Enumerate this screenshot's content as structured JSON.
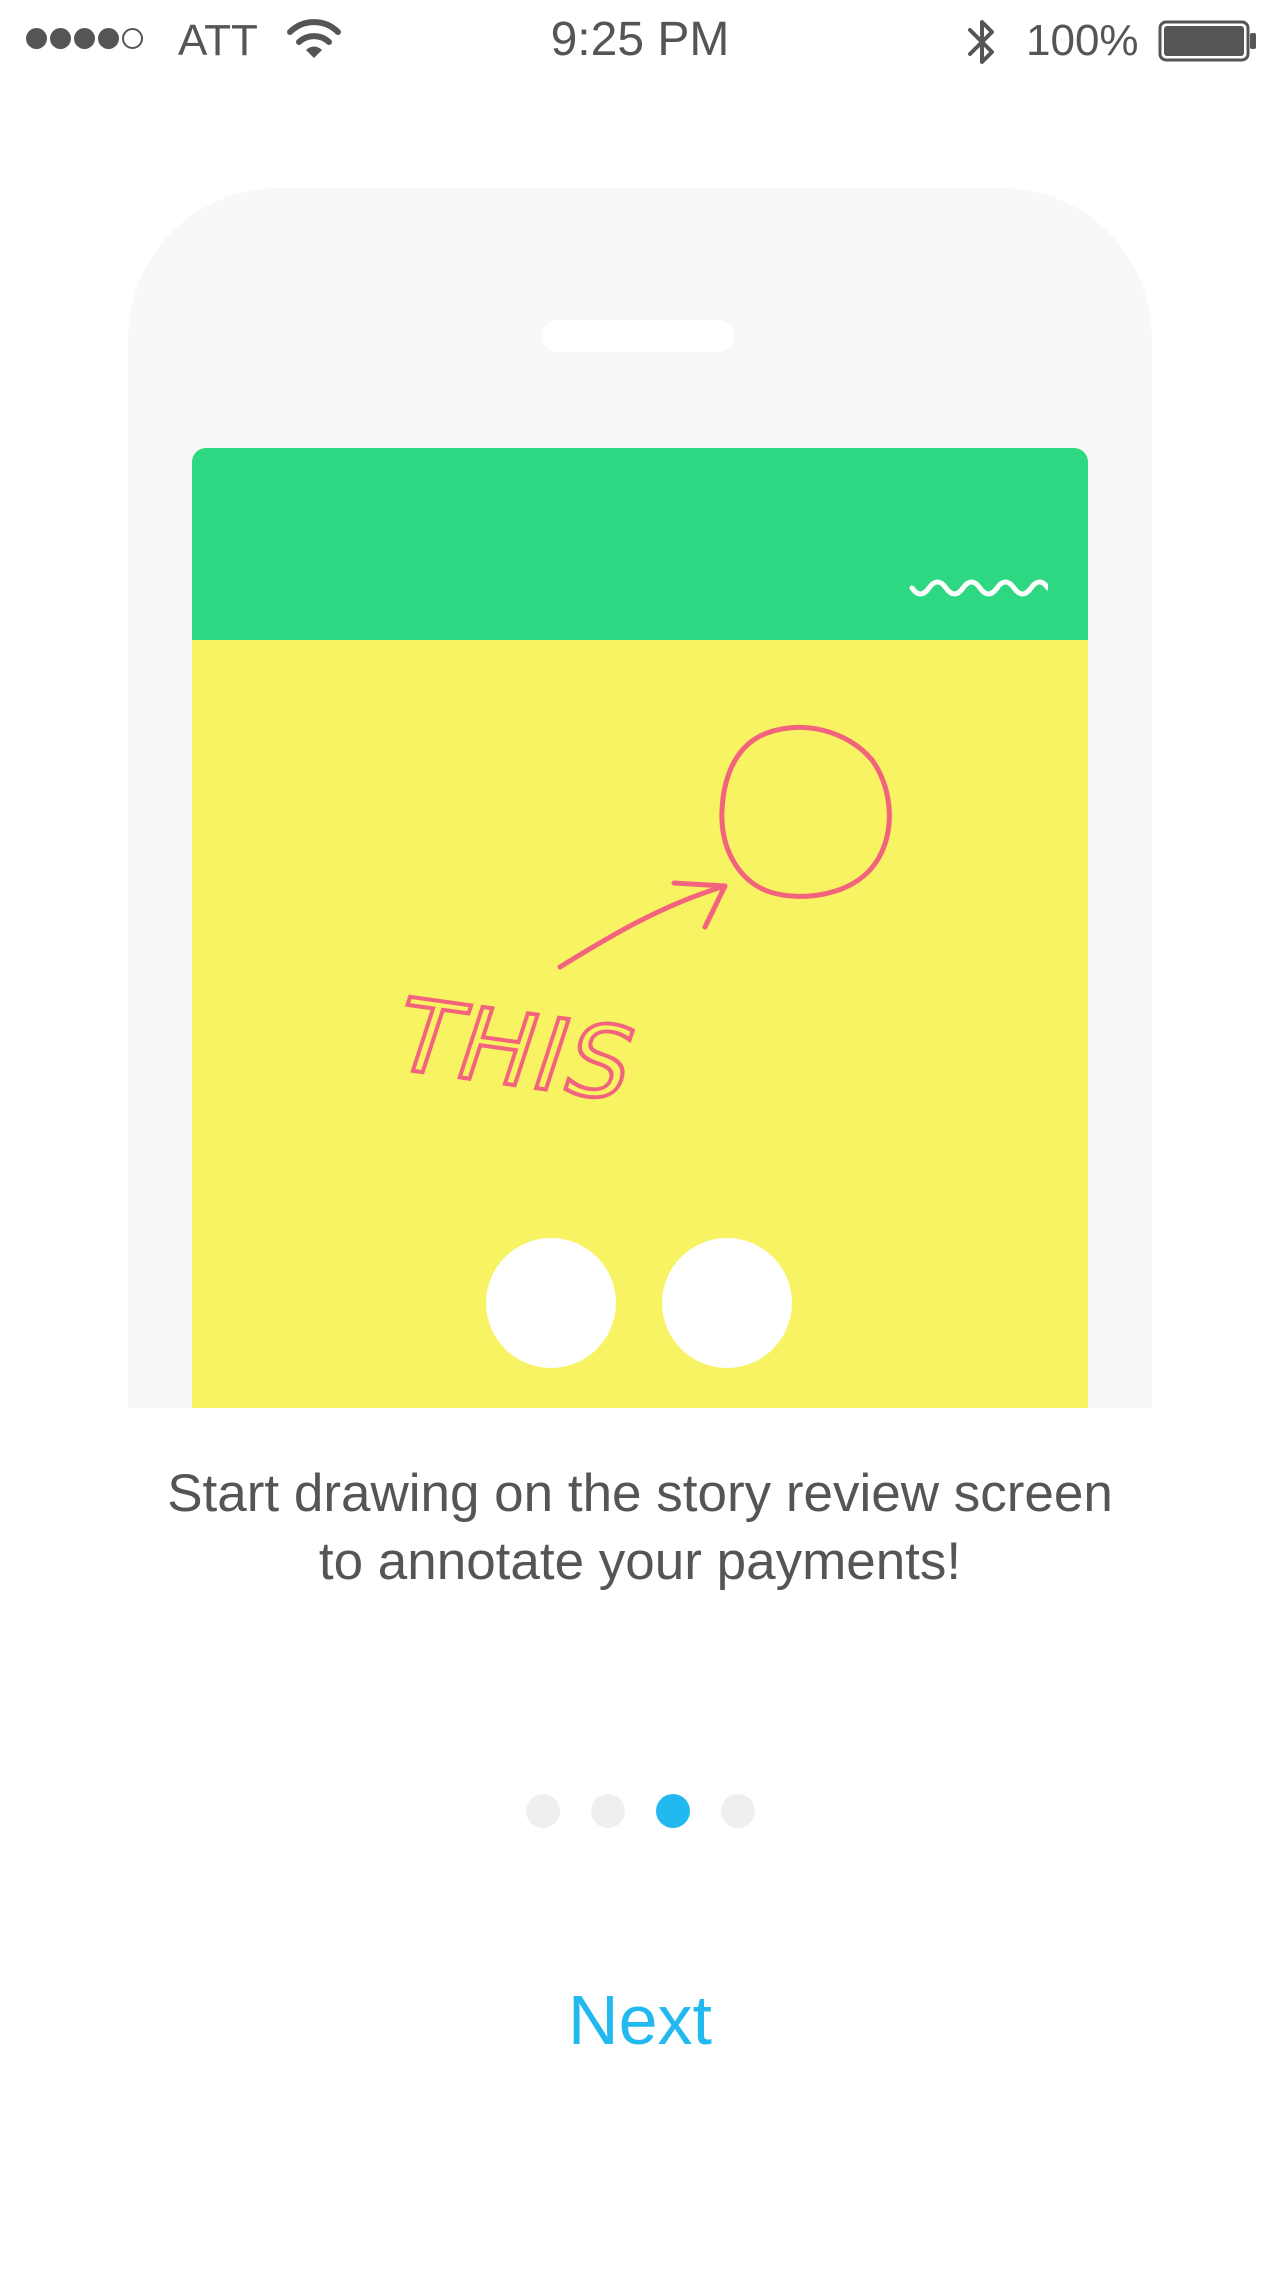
{
  "status_bar": {
    "signal_bars_filled": 4,
    "signal_bars_total": 5,
    "carrier": "ATT",
    "wifi_icon": "wifi-icon",
    "time": "9:25 PM",
    "bluetooth_icon": "bluetooth-icon",
    "battery_percent": "100%",
    "battery_level": 1.0
  },
  "illustration": {
    "header_color": "#2ed882",
    "screen_color": "#f7f362",
    "annotation_color": "#f2637e",
    "annotation_text": "THIS"
  },
  "onboarding": {
    "caption_line1": "Start drawing on the story review screen",
    "caption_line2": "to annotate your payments!",
    "page_count": 4,
    "current_page": 3,
    "next_label": "Next"
  },
  "colors": {
    "accent": "#22b8f0",
    "text": "#555555"
  }
}
